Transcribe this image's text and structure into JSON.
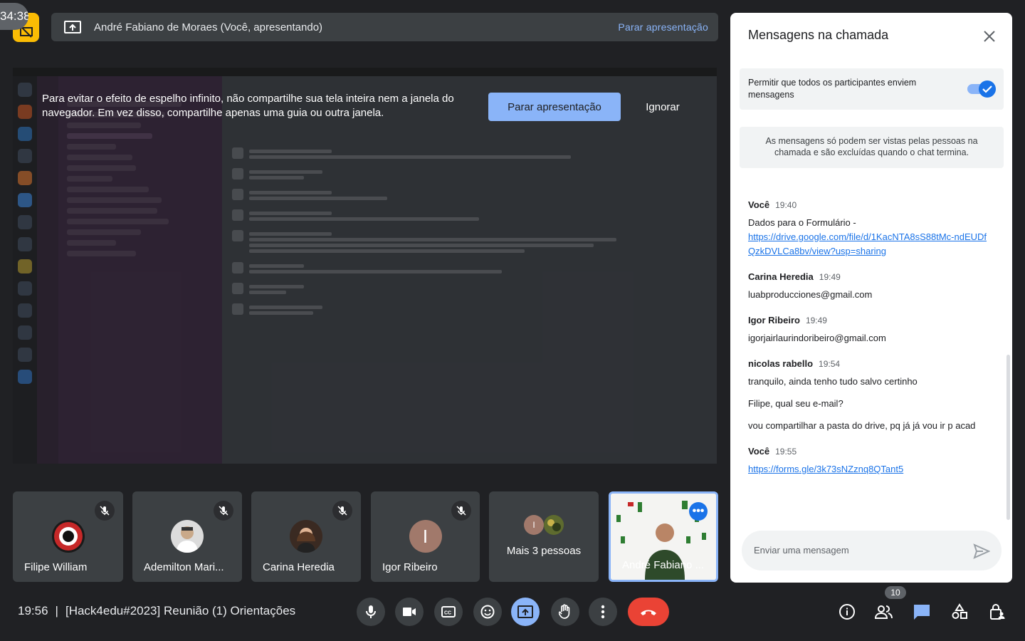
{
  "timer": "34:38",
  "presenting_bar": {
    "title": "André Fabiano de Moraes (Você, apresentando)",
    "stop_label": "Parar apresentação"
  },
  "shared_screen": {
    "warning": "Para evitar o efeito de espelho infinito, não compartilhe sua tela inteira nem a janela do navegador. Em vez disso, compartilhe apenas uma guia ou outra janela.",
    "stop_label": "Parar apresentação",
    "ignore_label": "Ignorar"
  },
  "participants": [
    {
      "name": "Filipe William",
      "muted": true
    },
    {
      "name": "Ademilton Mari...",
      "muted": true
    },
    {
      "name": "Carina Heredia",
      "muted": true
    },
    {
      "name": "Igor Ribeiro",
      "muted": true,
      "initial": "I"
    },
    {
      "name": "Mais 3 pessoas",
      "initial": "I"
    },
    {
      "name": "André Fabiano ..."
    }
  ],
  "meeting": {
    "time": "19:56",
    "separator": "|",
    "title": "[Hack4edu#2023] Reunião (1) Orientações"
  },
  "people_count": "10",
  "chat": {
    "title": "Mensagens na chamada",
    "allow_text": "Permitir que todos os participantes enviem mensagens",
    "allow_enabled": true,
    "info_text": "As mensagens só podem ser vistas pelas pessoas na chamada e são excluídas quando o chat termina.",
    "messages": [
      {
        "sender": "Você",
        "time": "19:40",
        "lines": [
          "Dados para o Formulário -"
        ],
        "link": "https://drive.google.com/file/d/1KacNTA8sS88tMc-ndEUDfQzkDVLCa8bv/view?usp=sharing"
      },
      {
        "sender": "Carina Heredia",
        "time": "19:49",
        "lines": [
          "luabproducciones@gmail.com"
        ]
      },
      {
        "sender": "Igor Ribeiro",
        "time": "19:49",
        "lines": [
          "igorjairlaurindoribeiro@gmail.com"
        ]
      },
      {
        "sender": "nicolas rabello",
        "time": "19:54",
        "lines": [
          "tranquilo, ainda tenho tudo salvo certinho",
          "Filipe, qual seu e-mail?",
          "vou compartilhar a pasta do drive, pq já já vou ir p acad"
        ]
      },
      {
        "sender": "Você",
        "time": "19:55",
        "link": "https://forms.gle/3k73sNZznq8QTant5"
      }
    ],
    "input_placeholder": "Enviar uma mensagem"
  },
  "colors": {
    "background": "#202124",
    "accent": "#8ab4f8",
    "end_call": "#ea4335",
    "badge": "#fbbc04"
  }
}
